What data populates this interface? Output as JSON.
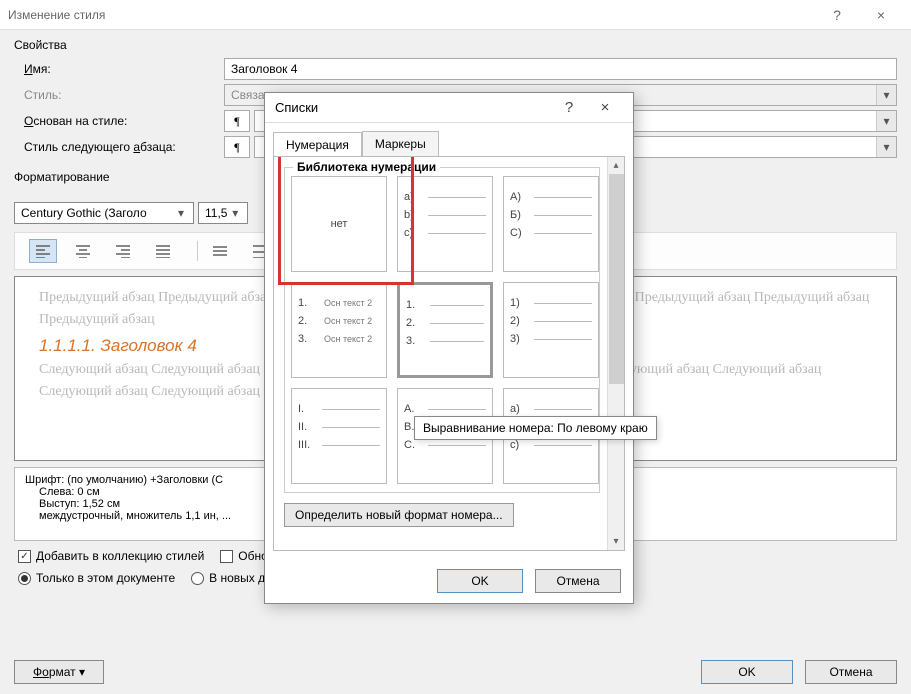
{
  "window": {
    "title": "Изменение стиля",
    "help": "?",
    "close": "×"
  },
  "props": {
    "section": "Свойства",
    "name_label_pre": "",
    "name_label_ul": "И",
    "name_label_post": "мя:",
    "name_value": "Заголовок 4",
    "type_label": "Стиль:",
    "type_value": "Связа",
    "based_pre": "",
    "based_ul": "О",
    "based_post": "снован на стиле:",
    "based_value": "¶ О",
    "next_pre": "Стиль следующего ",
    "next_ul": "а",
    "next_post": "бзаца:",
    "next_value": "¶ О"
  },
  "format": {
    "section": "Форматирование",
    "font": "Century Gothic (Заголо",
    "size": "11,5"
  },
  "preview": {
    "prev_para": "Предыдущий абзац Предыдущий абзац Предыдущий абзац Предыдущий абзац Предыдущий абзац Предыдущий абзац Предыдущий абзац Предыдущий абзац",
    "heading": "1.1.1.1. Заголовок 4",
    "next_para": "Следующий абзац Следующий абзац Следующий абзац Следующий абзац Следующий абзац Следующий абзац Следующий абзац Следующий абзац Следующий абзац Следующий абзац Следующий абзац Следующий абзац"
  },
  "desc": {
    "l1": "Шрифт: (по умолчанию) +Заголовки (С",
    "l2": "Слева:  0 см",
    "l3": "Выступ:  1,52 см",
    "l4": "междустрочный,  множитель 1,1 ин, ..."
  },
  "opts": {
    "add": "Добавить в коллекцию стилей",
    "auto": "Обновлять автоматически",
    "onlydoc": "Только в этом документе",
    "newdocs": "В новых документах, использующих этот шаблон"
  },
  "buttons": {
    "format_pre": "Ф",
    "format_ul": "о",
    "format_post": "рмат ▾",
    "ok": "OK",
    "cancel": "Отмена"
  },
  "lists": {
    "title": "Списки",
    "help": "?",
    "close": "×",
    "tab_num": "Нумерация",
    "tab_mark": "Маркеры",
    "lib": "Библиотека нумерации",
    "none": "нет",
    "c2": {
      "a": "a)",
      "b": "b)",
      "c": "c)"
    },
    "c3": {
      "a": "A)",
      "b": "Б)",
      "c": "С)"
    },
    "c4": {
      "a": "1. ",
      "b": "2. ",
      "c": "3. ",
      "t": "Осн текст 2"
    },
    "c5": {
      "a": "1.",
      "b": "2.",
      "c": "3."
    },
    "c6": {
      "a": "1)",
      "b": "2)",
      "c": "3)"
    },
    "c7": {
      "a": "I.",
      "b": "II.",
      "c": "III."
    },
    "c8": {
      "a": "A.",
      "b": "B.",
      "c": "C."
    },
    "c9": {
      "a": "a)",
      "b": "b)",
      "c": "c)"
    },
    "define": "Определить новый формат номера...",
    "ok": "OK",
    "cancel": "Отмена"
  },
  "tooltip": "Выравнивание номера: По левому краю"
}
